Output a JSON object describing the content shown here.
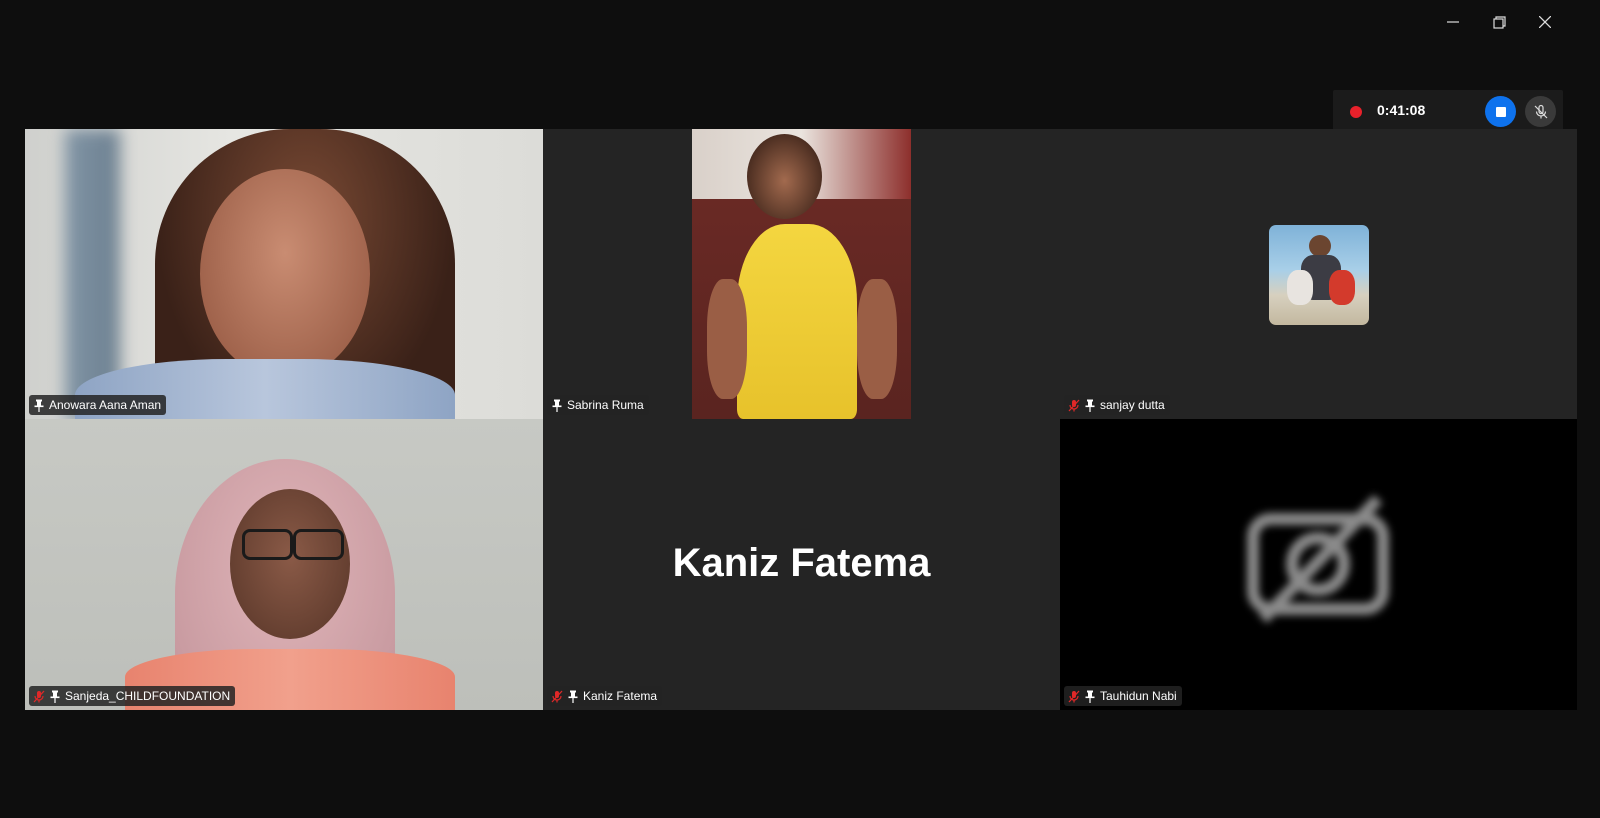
{
  "window": {
    "minimize_icon": "minimize-icon",
    "restore_icon": "restore-icon",
    "close_icon": "close-icon"
  },
  "recording": {
    "time": "0:41:08",
    "status_icon": "recording-dot-icon",
    "stop_icon": "stop-icon",
    "mic_icon": "mic-muted-icon"
  },
  "participants": [
    {
      "name": "Anowara Aana Aman",
      "muted": false,
      "pinned_icon": "pin-icon",
      "video": true,
      "active_speaker": true
    },
    {
      "name": "Sabrina Ruma",
      "muted": false,
      "pinned_icon": "pin-icon",
      "video": true
    },
    {
      "name": "sanjay dutta",
      "muted": true,
      "pinned_icon": "pin-icon",
      "video": false,
      "avatar": "profile-photo"
    },
    {
      "name": "Sanjeda_CHILDFOUNDATION",
      "muted": true,
      "pinned_icon": "pin-icon",
      "video": true
    },
    {
      "name": "Kaniz Fatema",
      "muted": true,
      "pinned_icon": "pin-icon",
      "video": false,
      "display_name": "Kaniz Fatema"
    },
    {
      "name": "Tauhidun Nabi",
      "muted": true,
      "pinned_icon": "pin-icon",
      "video": false,
      "camera_off_icon": "camera-off-icon"
    }
  ],
  "colors": {
    "background": "#0e0e0e",
    "tile": "#242424",
    "active_border": "#23d959",
    "record_red": "#e8212b",
    "stop_blue": "#0e72ed",
    "muted_red": "#e02828"
  }
}
